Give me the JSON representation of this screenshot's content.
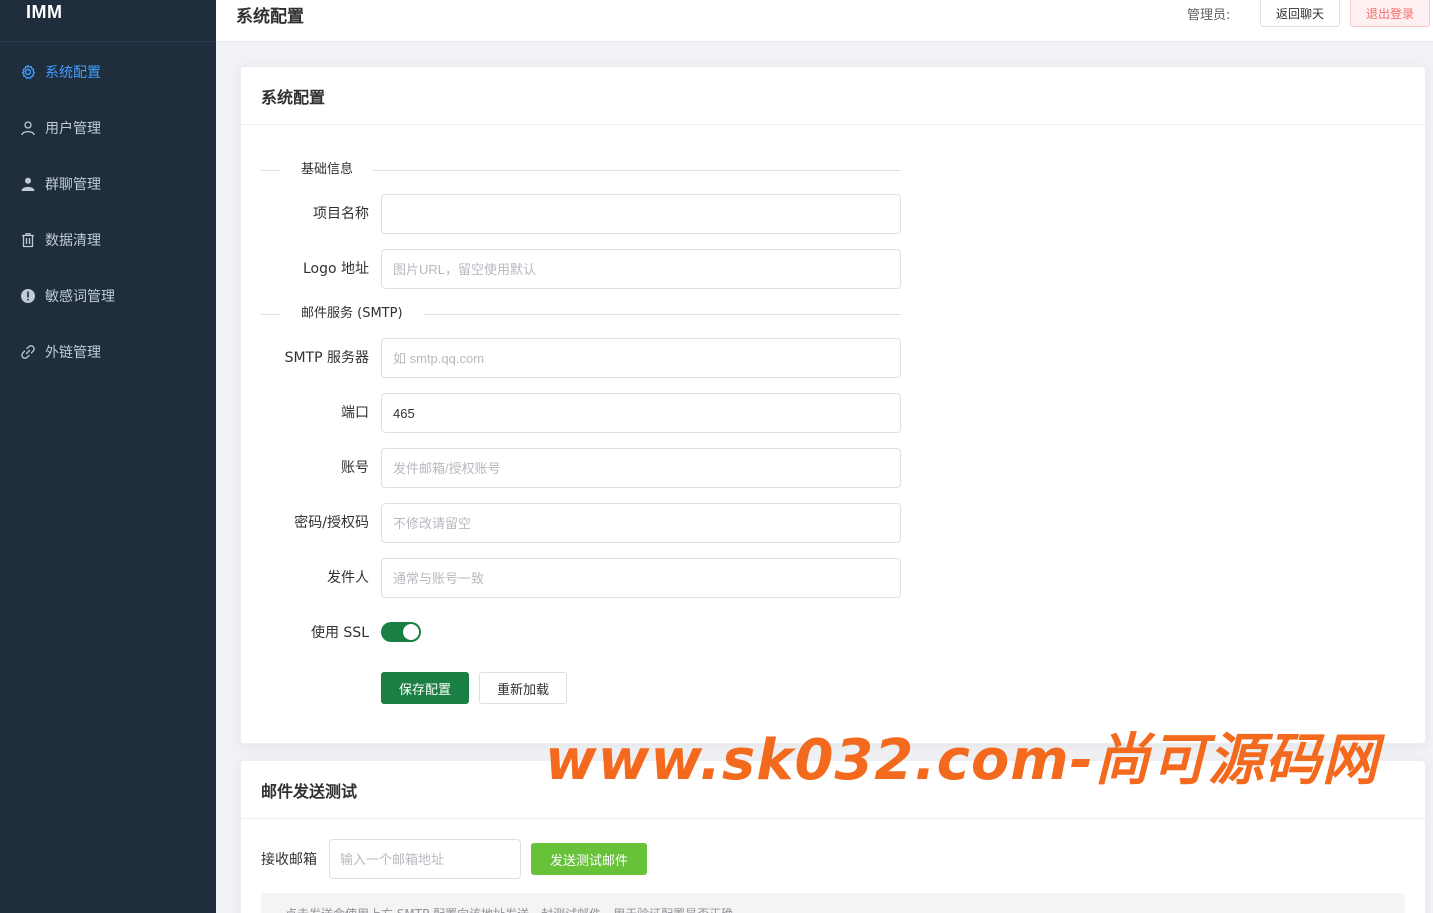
{
  "app": {
    "logo_text": "IMM"
  },
  "sidebar": {
    "items": [
      {
        "label": "系统配置",
        "icon": "gear-icon",
        "active": true
      },
      {
        "label": "用户管理",
        "icon": "user-icon",
        "active": false
      },
      {
        "label": "群聊管理",
        "icon": "group-icon",
        "active": false
      },
      {
        "label": "数据清理",
        "icon": "trash-icon",
        "active": false
      },
      {
        "label": "敏感词管理",
        "icon": "warning-icon",
        "active": false
      },
      {
        "label": "外链管理",
        "icon": "link-icon",
        "active": false
      }
    ]
  },
  "header": {
    "title": "系统配置",
    "admin_label": "管理员:",
    "back_button": "返回聊天",
    "logout_button": "退出登录"
  },
  "config_card": {
    "title": "系统配置",
    "basic_section": "基础信息",
    "project_name": {
      "label": "项目名称",
      "value": "",
      "placeholder": ""
    },
    "logo_url": {
      "label": "Logo 地址",
      "value": "",
      "placeholder": "图片URL，留空使用默认"
    },
    "smtp_section": "邮件服务 (SMTP)",
    "smtp_server": {
      "label": "SMTP 服务器",
      "value": "",
      "placeholder": "如 smtp.qq.com"
    },
    "port": {
      "label": "端口",
      "value": "465",
      "placeholder": ""
    },
    "account": {
      "label": "账号",
      "value": "",
      "placeholder": "发件邮箱/授权账号"
    },
    "password": {
      "label": "密码/授权码",
      "value": "",
      "placeholder": "不修改请留空"
    },
    "sender": {
      "label": "发件人",
      "value": "",
      "placeholder": "通常与账号一致"
    },
    "use_ssl": {
      "label": "使用 SSL",
      "enabled": true
    },
    "save_button": "保存配置",
    "reload_button": "重新加载"
  },
  "test_card": {
    "title": "邮件发送测试",
    "receiver_label": "接收邮箱",
    "receiver_placeholder": "输入一个邮箱地址",
    "send_button": "发送测试邮件",
    "note": "点击发送会使用上方 SMTP 配置向该地址发送一封测试邮件，用于验证配置是否正确"
  },
  "watermark": "www.sk032.com-尚可源码网",
  "colors": {
    "sidebar_bg": "#1f2d3d",
    "active": "#409eff",
    "primary_green": "#1a7f43",
    "success_green": "#67c23a",
    "danger": "#f56c6c",
    "watermark": "#f36a1f"
  }
}
